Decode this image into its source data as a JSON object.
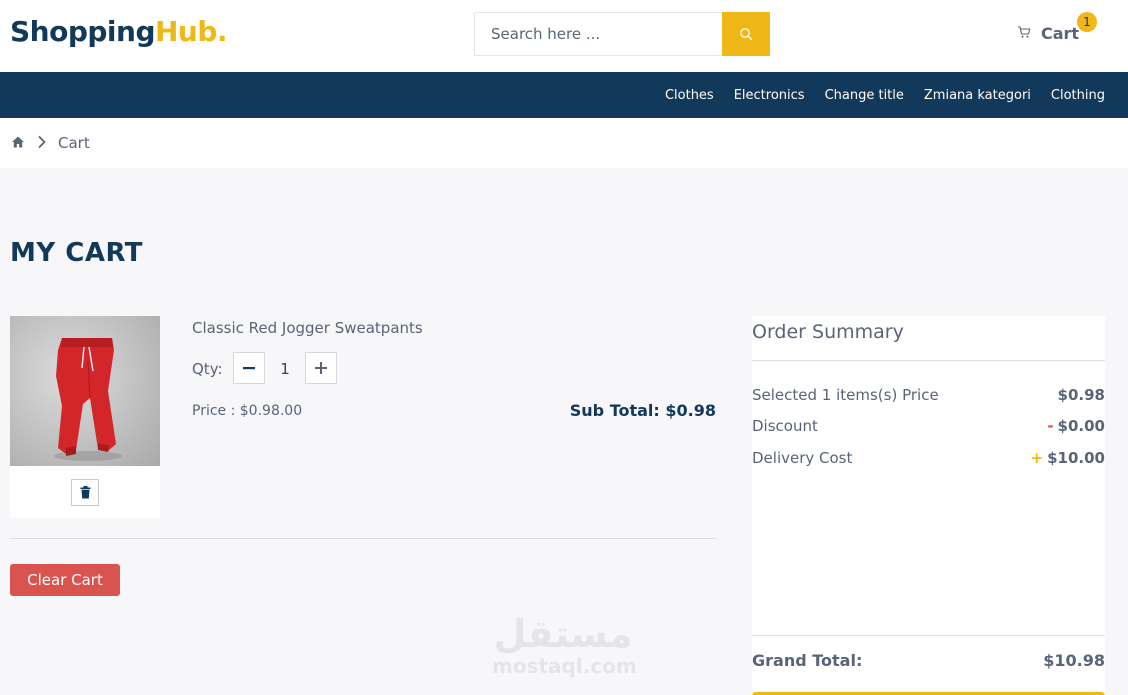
{
  "header": {
    "logo_part1": "Shopping",
    "logo_part2": "Hub.",
    "search_placeholder": "Search here ...",
    "cart_label": "Cart",
    "cart_count": "1"
  },
  "nav": {
    "items": [
      {
        "label": "Clothes"
      },
      {
        "label": "Electronics"
      },
      {
        "label": "Change title"
      },
      {
        "label": "Zmiana kategori"
      },
      {
        "label": "Clothing"
      }
    ]
  },
  "breadcrumb": {
    "current": "Cart"
  },
  "page": {
    "title": "MY CART"
  },
  "cart_item": {
    "name": "Classic Red Jogger Sweatpants",
    "qty_label": "Qty:",
    "qty": "1",
    "price": "Price : $0.98.00",
    "subtotal": "Sub Total: $0.98"
  },
  "actions": {
    "clear_cart": "Clear Cart"
  },
  "summary": {
    "title": "Order Summary",
    "rows": [
      {
        "label": "Selected 1 items(s) Price",
        "sign": "",
        "value": "$0.98"
      },
      {
        "label": "Discount",
        "sign": "-",
        "value": "$0.00"
      },
      {
        "label": "Delivery Cost",
        "sign": "+",
        "value": "$10.00"
      }
    ],
    "grand_total_label": "Grand Total:",
    "grand_total_value": "$10.98"
  },
  "watermark": {
    "arabic": "مستقل",
    "latin": "mostaql.com"
  },
  "colors": {
    "brand_navy": "#12385a",
    "brand_yellow": "#f0b816",
    "danger": "#d9534f"
  }
}
